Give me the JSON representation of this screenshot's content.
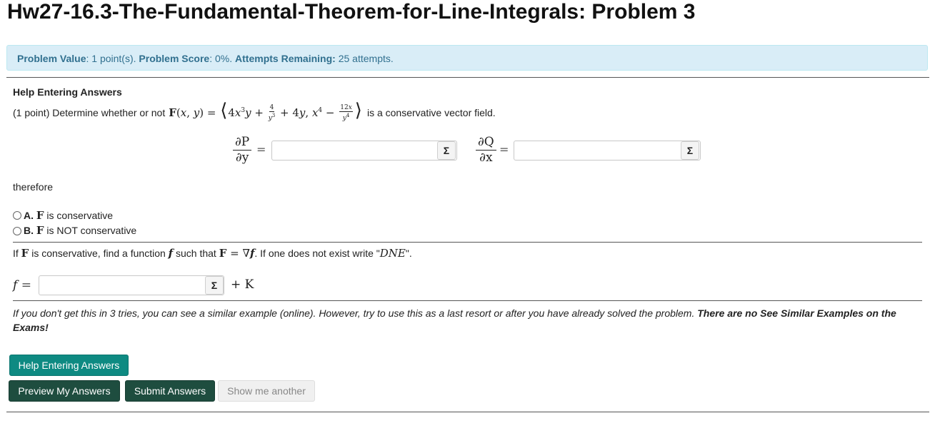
{
  "page": {
    "title": "Hw27-16.3-The-Fundamental-Theorem-for-Line-Integrals: Problem 3"
  },
  "info": {
    "value_label": "Problem Value",
    "value_text": ": 1 point(s). ",
    "score_label": "Problem Score",
    "score_text": ": 0%. ",
    "attempts_label": "Attempts Remaining:",
    "attempts_text": " 25 attempts."
  },
  "help_link": "Help Entering Answers",
  "problem": {
    "intro": "(1 point) Determine whether or not",
    "suffix": "is a conservative vector field."
  },
  "partials": {
    "dp_num": "∂P",
    "dp_den": "∂y",
    "dq_num": "∂Q",
    "dq_den": "∂x",
    "dp_value": "",
    "dq_value": ""
  },
  "therefore": "therefore",
  "choices": [
    {
      "letter": "A.",
      "text": " is conservative"
    },
    {
      "letter": "B.",
      "text": " is NOT conservative"
    }
  ],
  "potential": {
    "instruction_pre": "If ",
    "instruction_mid": " is conservative, find a function ",
    "instruction_mid2": " such that ",
    "instruction_end": ". If one does not exist write \"",
    "dne": "DNE",
    "instruction_close": "\".",
    "f_value": "",
    "plus_k": "+ K"
  },
  "note": {
    "text": "If you don't get this in 3 tries, you can see a similar example (online). However, try to use this as a last resort or after you have already solved the problem. ",
    "bold": "There are no See Similar Examples on the Exams!"
  },
  "buttons": {
    "help": "Help Entering Answers",
    "preview": "Preview My Answers",
    "submit": "Submit Answers",
    "another": "Show me another"
  },
  "icons": {
    "sigma": "Σ"
  }
}
